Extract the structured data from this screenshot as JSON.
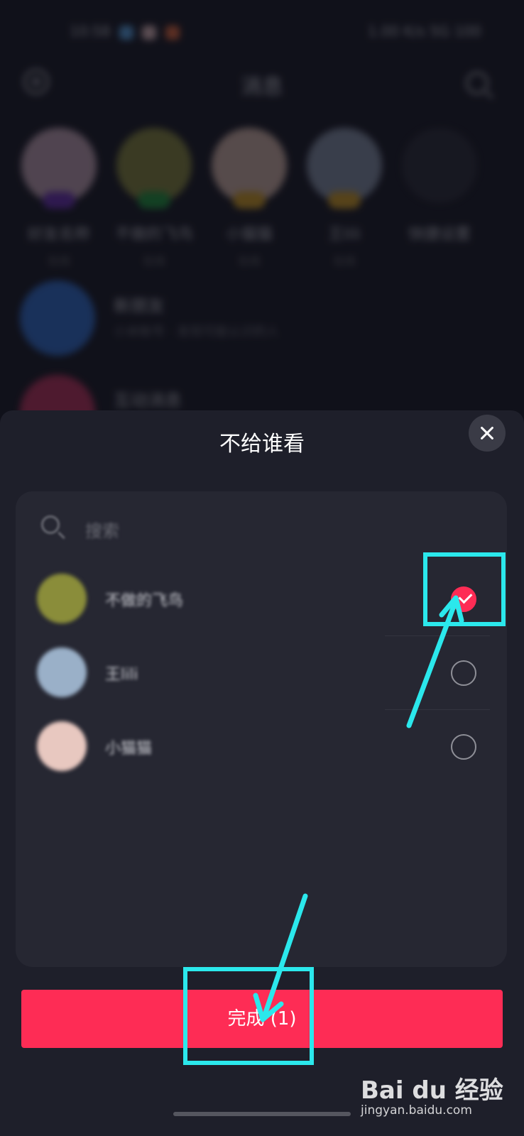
{
  "status_bar": {
    "time": "10:58",
    "network": "1.00 K/s",
    "signal": "5G",
    "battery": "100"
  },
  "nav": {
    "title": "消息"
  },
  "contacts": [
    {
      "name": "好友名称",
      "sub": "在线",
      "color": "#c8a7b6",
      "tag": "#6b2fb5"
    },
    {
      "name": "不做的飞鸟",
      "sub": "在线",
      "color": "#8a8a3a",
      "tag": "#1f9a3a"
    },
    {
      "name": "小猫猫",
      "sub": "在线",
      "color": "#d9b8a8",
      "tag": "#d9a21f"
    },
    {
      "name": "王lili",
      "sub": "在线",
      "color": "#8894a8",
      "tag": "#d9a21f"
    },
    {
      "name": "快捷设置",
      "sub": "",
      "color": "#2a2b34",
      "tag": ""
    }
  ],
  "messages": [
    {
      "title": "新朋友",
      "preview": "小米帐号 · 发现可能认识的人",
      "color": "#2f6fd1"
    },
    {
      "title": "互动消息",
      "preview": "",
      "color": "#c0315a"
    }
  ],
  "sheet": {
    "title": "不给谁看",
    "search_placeholder": "搜索",
    "friends": [
      {
        "name": "不做的飞鸟",
        "checked": true,
        "avatar_color": "#8a8d3a"
      },
      {
        "name": "王lili",
        "checked": false,
        "avatar_color": "#9ab0c8"
      },
      {
        "name": "小猫猫",
        "checked": false,
        "avatar_color": "#e8c8c0"
      }
    ],
    "done_label": "完成 (1)"
  },
  "colors": {
    "accent": "#fe2c55",
    "highlight": "#2be8ec",
    "sheet_bg": "#1e1f2a",
    "card_bg": "#262732"
  },
  "watermark": {
    "logo": "Bai du 经验",
    "url": "jingyan.baidu.com"
  }
}
